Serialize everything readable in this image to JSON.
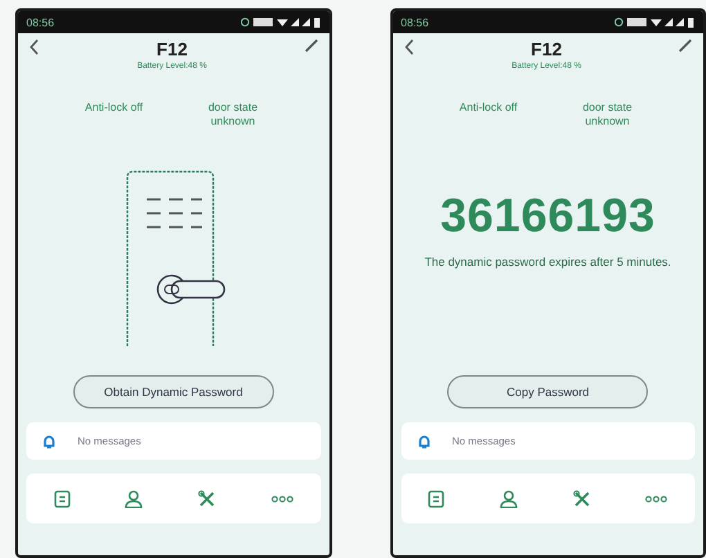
{
  "phones": [
    {
      "status_bar": {
        "time": "08:56"
      },
      "header": {
        "title": "F12",
        "battery": "Battery Level:48 %"
      },
      "states": {
        "anti_lock": "Anti-lock off",
        "door_state": "door state unknown"
      },
      "main": {
        "kind": "lock"
      },
      "action_button": "Obtain Dynamic Password",
      "messages": "No messages"
    },
    {
      "status_bar": {
        "time": "08:56"
      },
      "header": {
        "title": "F12",
        "battery": "Battery Level:48 %"
      },
      "states": {
        "anti_lock": "Anti-lock off",
        "door_state": "door state unknown"
      },
      "main": {
        "kind": "password",
        "password": "36166193",
        "note": "The dynamic password expires after 5 minutes."
      },
      "action_button": "Copy Password",
      "messages": "No messages"
    }
  ]
}
